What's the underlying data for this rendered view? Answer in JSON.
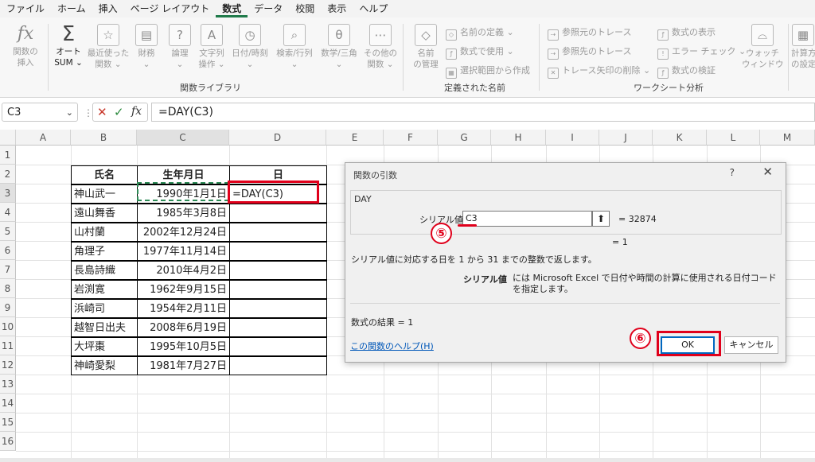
{
  "menu": [
    "ファイル",
    "ホーム",
    "挿入",
    "ページ レイアウト",
    "数式",
    "データ",
    "校閲",
    "表示",
    "ヘルプ"
  ],
  "ribbon": {
    "fx_label": "関数の\n挿入",
    "autosum_label": "オート\nSUM ⌄",
    "recent_label": "最近使った\n関数 ⌄",
    "finance_label": "財務\n⌄",
    "logic_label": "論理\n⌄",
    "text_label": "文字列\n操作 ⌄",
    "datetime_label": "日付/時刻\n⌄",
    "lookup_label": "検索/行列\n⌄",
    "math_label": "数学/三角\n⌄",
    "other_label": "その他の\n関数 ⌄",
    "lib_group": "関数ライブラリ",
    "name_mgr_label": "名前\nの管理",
    "define_name": "名前の定義 ⌄",
    "use_in_formula": "数式で使用 ⌄",
    "create_from_sel": "選択範囲から作成",
    "names_group": "定義された名前",
    "trace_prec": "参照元のトレース",
    "trace_dep": "参照先のトレース",
    "remove_arrows": "トレース矢印の削除 ⌄",
    "show_formulas": "数式の表示",
    "error_check": "エラー チェック ⌄",
    "eval_formula": "数式の検証",
    "audit_group": "ワークシート分析",
    "watch_label": "ウォッチ\nウィンドウ",
    "calc_label": "計算方\nの設定"
  },
  "formula_bar": {
    "name_box": "C3",
    "formula": "=DAY(C3)"
  },
  "columns": [
    "A",
    "B",
    "C",
    "D",
    "E",
    "F",
    "G",
    "H",
    "I",
    "J",
    "K",
    "L",
    "M"
  ],
  "rows": [
    "1",
    "2",
    "3",
    "4",
    "5",
    "6",
    "7",
    "8",
    "9",
    "10",
    "11",
    "12",
    "13",
    "14",
    "15",
    "16"
  ],
  "table": {
    "headers": [
      "氏名",
      "生年月日",
      "日"
    ],
    "rows": [
      [
        "神山武一",
        "1990年1月1日",
        "=DAY(C3)"
      ],
      [
        "遠山舞香",
        "1985年3月8日",
        ""
      ],
      [
        "山村蘭",
        "2002年12月24日",
        ""
      ],
      [
        "角理子",
        "1977年11月14日",
        ""
      ],
      [
        "長島詩織",
        "2010年4月2日",
        ""
      ],
      [
        "岩渕寛",
        "1962年9月15日",
        ""
      ],
      [
        "浜崎司",
        "1954年2月11日",
        ""
      ],
      [
        "越智日出夫",
        "2008年6月19日",
        ""
      ],
      [
        "大坪棗",
        "1995年10月5日",
        ""
      ],
      [
        "神崎愛梨",
        "1981年7月27日",
        ""
      ]
    ]
  },
  "dialog": {
    "title": "関数の引数",
    "help_q": "?",
    "close": "✕",
    "function_name": "DAY",
    "arg_label": "シリアル値",
    "arg_value": "C3",
    "arg_result": "=  32874",
    "formula_result_preview": "=  1",
    "description": "シリアル値に対応する日を 1 から 31 までの整数で返します。",
    "arg_desc_label": "シリアル値",
    "arg_desc_text": "には Microsoft Excel で日付や時間の計算に使用される日付コードを指定します。",
    "result_text": "数式の結果 =   1",
    "help_link": "この関数のヘルプ(H)",
    "ok": "OK",
    "cancel": "キャンセル"
  },
  "annotations": {
    "step5": "⑤",
    "step6": "⑥"
  },
  "colors": {
    "accent": "#1f7a4a",
    "highlight": "#e0001b",
    "link": "#0057b8"
  }
}
